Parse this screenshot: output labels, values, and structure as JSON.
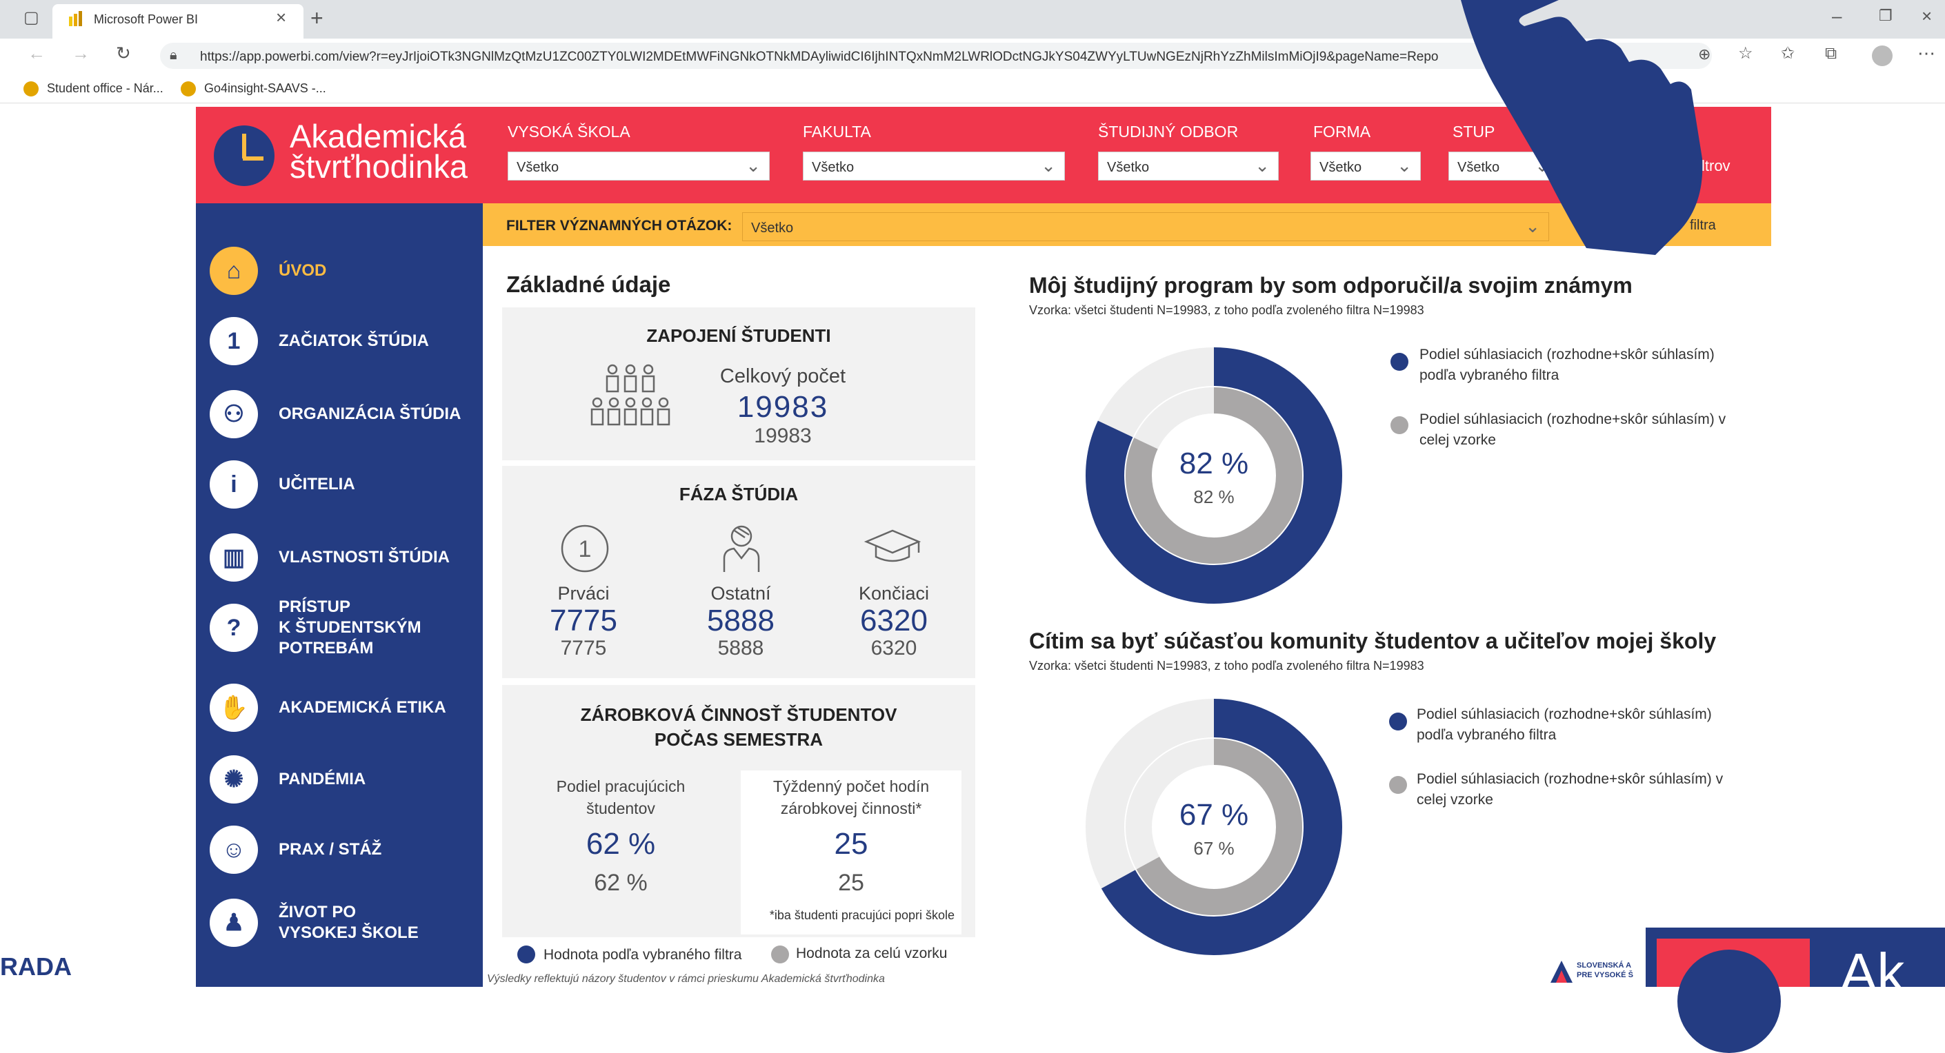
{
  "browser": {
    "tab_title": "Microsoft Power BI",
    "url": "https://app.powerbi.com/view?r=eyJrIjoiOTk3NGNlMzQtMzU1ZC00ZTY0LWI2MDEtMWFiNGNkOTNkMDAyliwidCI6IjhINTQxNmM2LWRlODctNGJkYS04ZWYyLTUwNGEzNjRhYzZhMilsImMiOjI9&pageName=Repo",
    "bookmarks": [
      "Student office - Nár...",
      "Go4insight-SAAVS -..."
    ]
  },
  "brand": {
    "line1": "Akademická",
    "line2": "štvrťhodinka"
  },
  "filters": [
    {
      "label": "VYSOKÁ ŠKOLA",
      "value": "Všetko"
    },
    {
      "label": "FAKULTA",
      "value": "Všetko"
    },
    {
      "label": "ŠTUDIJNÝ ODBOR",
      "value": "Všetko"
    },
    {
      "label": "FORMA",
      "value": "Všetko"
    },
    {
      "label": "STUP",
      "value": "Všetko"
    }
  ],
  "reset_filters_label": "filtrov",
  "question_filter": {
    "label": "FILTER VÝZNAMNÝCH OTÁZOK:",
    "value": "Všetko",
    "reset": "filtra"
  },
  "nav": [
    {
      "label": "ÚVOD",
      "icon": "home-icon"
    },
    {
      "label": "ZAČIATOK ŠTÚDIA",
      "icon": "number-one-icon"
    },
    {
      "label": "ORGANIZÁCIA ŠTÚDIA",
      "icon": "network-icon"
    },
    {
      "label": "UČITELIA",
      "icon": "person-icon"
    },
    {
      "label": "VLASTNOSTI ŠTÚDIA",
      "icon": "books-icon"
    },
    {
      "label": "PRÍSTUP\nK ŠTUDENTSKÝM\nPOTREBÁM",
      "icon": "help-person-icon"
    },
    {
      "label": "AKADEMICKÁ ETIKA",
      "icon": "handshake-icon"
    },
    {
      "label": "PANDÉMIA",
      "icon": "virus-icon"
    },
    {
      "label": "PRAX / STÁŽ",
      "icon": "worker-icon"
    },
    {
      "label": "ŽIVOT PO\nVYSOKEJ ŠKOLE",
      "icon": "graduate-icon"
    }
  ],
  "basic": {
    "title": "Základné údaje",
    "participants": {
      "title": "ZAPOJENÍ ŠTUDENTI",
      "label": "Celkový počet",
      "value": "19983",
      "total": "19983"
    },
    "phase": {
      "title": "FÁZA ŠTÚDIA",
      "items": [
        {
          "label": "Prváci",
          "value": "7775",
          "total": "7775",
          "icon": "circle-one-icon"
        },
        {
          "label": "Ostatní",
          "value": "5888",
          "total": "5888",
          "icon": "student-icon"
        },
        {
          "label": "Končiaci",
          "value": "6320",
          "total": "6320",
          "icon": "graduation-cap-icon"
        }
      ]
    },
    "work": {
      "title1": "ZÁROBKOVÁ ČINNOSŤ ŠTUDENTOV",
      "title2": "POČAS SEMESTRA",
      "share_label1": "Podiel pracujúcich",
      "share_label2": "študentov",
      "share_value": "62 %",
      "share_total": "62 %",
      "hours_label1": "Týždenný počet hodín",
      "hours_label2": "zárobkovej činnosti*",
      "hours_value": "25",
      "hours_total": "25",
      "note": "*iba študenti pracujúci popri škole"
    },
    "legend": {
      "selected": "Hodnota podľa vybraného filtra",
      "overall": "Hodnota za celú vzorku"
    },
    "footnote": "Výsledky reflektujú názory študentov v rámci prieskumu Akademická štvrťhodinka"
  },
  "colors": {
    "navy": "#243c82",
    "red": "#f0374c",
    "yellow": "#fdbc42",
    "grey": "#a9a7a7",
    "light": "#eeeeee"
  },
  "charts": [
    {
      "title": "Môj študijný program by som odporučil/a svojim známym",
      "sample": "Vzorka: všetci študenti N=19983, z toho podľa zvoleného filtra N=19983",
      "value_label": "82 %",
      "total_label": "82 %",
      "legend1": "Podiel súhlasiacich (rozhodne+skôr súhlasím) podľa vybraného filtra",
      "legend2": "Podiel súhlasiacich (rozhodne+skôr súhlasím) v celej vzorke"
    },
    {
      "title": "Cítim sa byť súčasťou komunity študentov a učiteľov mojej školy",
      "sample": "Vzorka: všetci študenti N=19983, z toho podľa zvoleného filtra N=19983",
      "value_label": "67 %",
      "total_label": "67 %",
      "legend1": "Podiel súhlasiacich (rozhodne+skôr súhlasím) podľa vybraného filtra",
      "legend2": "Podiel súhlasiacich (rozhodne+skôr súhlasím) v celej vzorke"
    }
  ],
  "chart_data": [
    {
      "type": "pie",
      "categories": [
        "Podiel súhlasiacich (rozhodne+skôr súhlasím) podľa vybraného filtra",
        "Podiel súhlasiacich (rozhodne+skôr súhlasím) v celej vzorke"
      ],
      "values": [
        82,
        82
      ]
    },
    {
      "type": "pie",
      "categories": [
        "Podiel súhlasiacich (rozhodne+skôr súhlasím) podľa vybraného filtra",
        "Podiel súhlasiacich (rozhodne+skôr súhlasím) v celej vzorke"
      ],
      "values": [
        67,
        67
      ]
    }
  ],
  "footer": {
    "left_text": "RADA",
    "partner_text": "SLOVENSKÁ A\nPRE VYSOKÉ Š",
    "corner_text": "Ak"
  }
}
